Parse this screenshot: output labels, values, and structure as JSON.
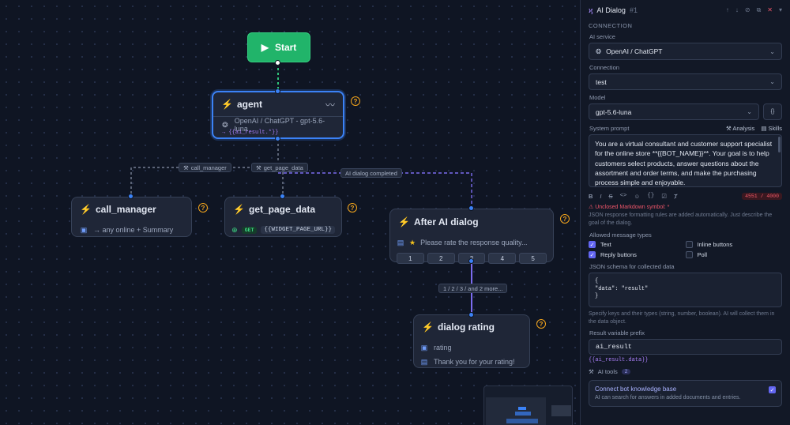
{
  "canvas": {
    "start_label": "Start",
    "agent": {
      "title": "agent",
      "service": "OpenAI / ChatGPT - gpt-5.6-luna",
      "result_var": "→ {{ai_result.*}}"
    },
    "call_manager": {
      "title": "call_manager",
      "summary": "→ any online + Summary"
    },
    "get_page_data": {
      "title": "get_page_data",
      "method": "GET",
      "url": "{{WIDGET_PAGE_URL}}"
    },
    "after_ai_dialog": {
      "title": "After AI dialog",
      "message": "Please rate the response quality...",
      "options": [
        "1",
        "2",
        "3",
        "4",
        "5"
      ]
    },
    "dialog_rating": {
      "title": "dialog rating",
      "variable": "rating",
      "message": "Thank you for your rating!"
    },
    "edge_labels": {
      "call_manager": "call_manager",
      "get_page_data": "get_page_data",
      "completed": "AI dialog completed",
      "options": "1 / 2 / 3 / and 2 more..."
    },
    "help_glyph": "?"
  },
  "panel": {
    "title": "AI Dialog",
    "subtitle": "#1",
    "section_connection": "CONNECTION",
    "ai_service_label": "AI service",
    "ai_service_value": "OpenAI / ChatGPT",
    "connection_label": "Connection",
    "connection_value": "test",
    "model_label": "Model",
    "model_value": "gpt-5.6-luna",
    "model_var_btn": "{}",
    "system_prompt_label": "System prompt",
    "analysis_label": "Analysis",
    "skills_label": "Skills",
    "system_prompt_text": "You are a virtual consultant and customer support specialist for the online store **{{BOT_NAME}}**. Your goal is to help customers select products, answer questions about the assortment and order terms, and make the purchasing process simple and enjoyable.",
    "counter": "4551 / 4000",
    "warning": "Unclosed Markdown symbol: *",
    "json_note": "JSON response formatting rules are added automatically. Just describe the goal of the dialog.",
    "allowed_types_label": "Allowed message types",
    "types": [
      {
        "label": "Text",
        "checked": true
      },
      {
        "label": "Inline buttons",
        "checked": false
      },
      {
        "label": "Reply buttons",
        "checked": true
      },
      {
        "label": "Poll",
        "checked": false
      }
    ],
    "json_schema_label": "JSON schema for collected data",
    "json_schema": "{\n\"data\": \"result\"\n}",
    "schema_note": "Specify keys and their types (string, number, boolean). AI will collect them in the data object.",
    "result_var_label": "Result variable prefix",
    "result_var_value": "ai_result",
    "result_var_hint": "{{ai_result.data}}",
    "ai_tools_label": "AI tools",
    "ai_tools_count": "2",
    "kb_title": "Connect bot knowledge base",
    "kb_desc": "AI can search for answers in added documents and entries."
  },
  "colors": {
    "accent": "#3b82f6",
    "start": "#21b46a",
    "edge_purple": "#7c6cf0",
    "warning": "#f4a51c",
    "error": "#f0566a"
  }
}
